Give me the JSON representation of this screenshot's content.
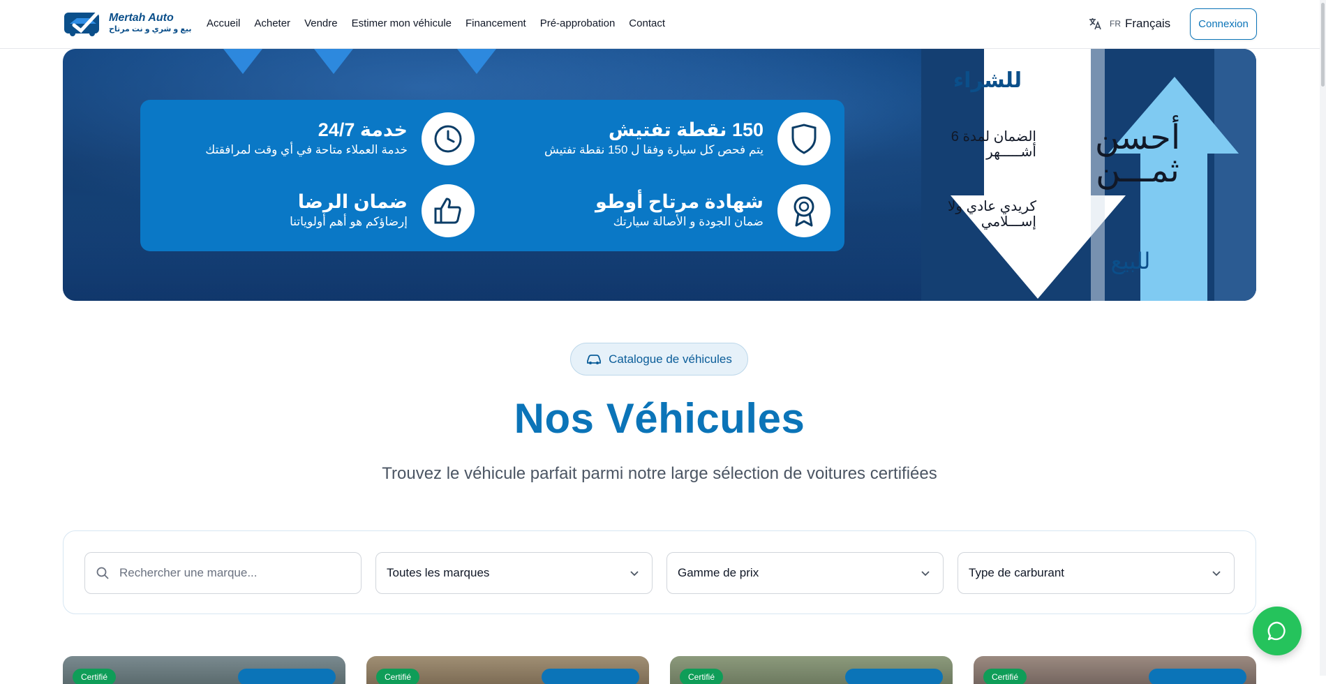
{
  "header": {
    "logo": {
      "title": "Mertah Auto",
      "subtitle": "بيع و شري و نت مرتاح"
    },
    "nav": [
      "Accueil",
      "Acheter",
      "Vendre",
      "Estimer mon véhicule",
      "Financement",
      "Pré-approbation",
      "Contact"
    ],
    "language": {
      "code": "FR",
      "name": "Français"
    },
    "login_label": "Connexion"
  },
  "banner": {
    "features": [
      {
        "title": "150 نقطة تفتيش",
        "desc": "يتم فحص كل سيارة وفقا ل 150 نقطة تفتيش",
        "icon": "shield-icon"
      },
      {
        "title": "خدمة 24/7",
        "desc": "خدمة العملاء متاحة في أي وقت لمرافقتك",
        "icon": "clock-icon"
      },
      {
        "title": "شهادة مرتاح أوطو",
        "desc": "ضمان الجودة و الأصالة سيارتك",
        "icon": "award-icon"
      },
      {
        "title": "ضمان الرضا",
        "desc": "إرضاؤكم هو أهم أولوياتنا",
        "icon": "thumbs-up-icon"
      }
    ],
    "arrow_top": "للشراء",
    "warranty": "الضمان لمدة 6 أشـــــهر",
    "credit": "كريدي عادي ولا إســـلامي",
    "best_price_1": "أحسن",
    "best_price_2": "ثمـــن",
    "arrow_bottom": "للبيع"
  },
  "catalogue": {
    "pill_label": "Catalogue de véhicules",
    "title": "Nos Véhicules",
    "subtitle": "Trouvez le véhicule parfait parmi notre large sélection de voitures certifiées"
  },
  "filters": {
    "search_placeholder": "Rechercher une marque...",
    "brand": "Toutes les marques",
    "price": "Gamme de prix",
    "fuel": "Type de carburant"
  },
  "cards": [
    {
      "badge": "Certifié"
    },
    {
      "badge": "Certifié"
    },
    {
      "badge": "Certifié"
    },
    {
      "badge": "Certifié"
    }
  ],
  "colors": {
    "primary": "#0b74b8",
    "banner_blue": "#0a78c6",
    "whatsapp": "#25c35c"
  }
}
